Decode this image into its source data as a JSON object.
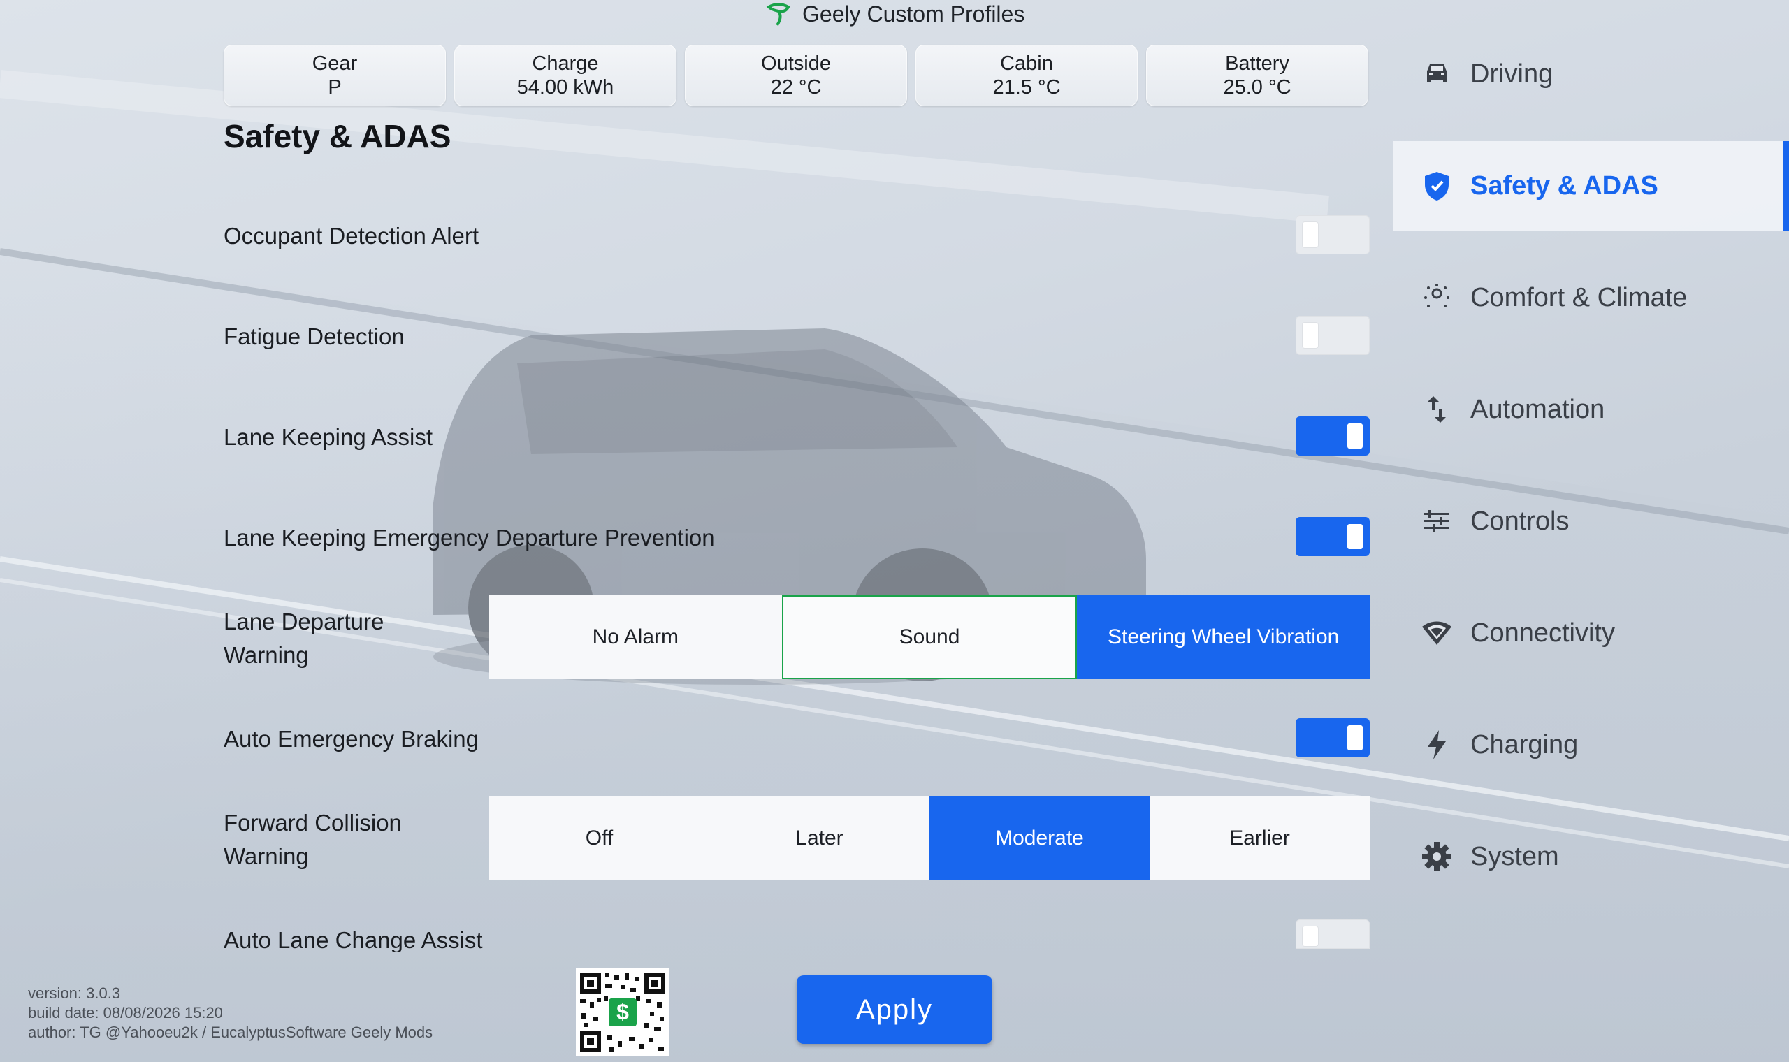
{
  "app": {
    "title": "Geely Custom Profiles"
  },
  "stats": [
    {
      "label": "Gear",
      "value": "P"
    },
    {
      "label": "Charge",
      "value": "54.00 kWh"
    },
    {
      "label": "Outside",
      "value": "22 °C"
    },
    {
      "label": "Cabin",
      "value": "21.5 °C"
    },
    {
      "label": "Battery",
      "value": "25.0 °C"
    }
  ],
  "page": {
    "title": "Safety & ADAS"
  },
  "settings": {
    "occupant_detection": {
      "label": "Occupant Detection Alert",
      "enabled": false
    },
    "fatigue_detection": {
      "label": "Fatigue Detection",
      "enabled": false
    },
    "lane_keeping_assist": {
      "label": "Lane Keeping Assist",
      "enabled": true
    },
    "lane_keeping_emergency": {
      "label": "Lane Keeping Emergency Departure Prevention",
      "enabled": true
    },
    "lane_departure_warning": {
      "label_line1": "Lane Departure",
      "label_line2": "Warning",
      "options": [
        "No Alarm",
        "Sound",
        "Steering Wheel Vibration"
      ],
      "selected": "Steering Wheel Vibration"
    },
    "auto_emergency_braking": {
      "label": "Auto Emergency Braking",
      "enabled": true
    },
    "forward_collision_warning": {
      "label_line1": "Forward Collision",
      "label_line2": "Warning",
      "options": [
        "Off",
        "Later",
        "Moderate",
        "Earlier"
      ],
      "selected": "Moderate"
    },
    "auto_lane_change": {
      "label": "Auto Lane Change Assist",
      "enabled": false
    }
  },
  "sidebar": {
    "items": [
      {
        "label": "Driving",
        "icon": "car-icon",
        "active": false
      },
      {
        "label": "Safety & ADAS",
        "icon": "shield-icon",
        "active": true
      },
      {
        "label": "Comfort & Climate",
        "icon": "climate-icon",
        "active": false
      },
      {
        "label": "Automation",
        "icon": "swap-icon",
        "active": false
      },
      {
        "label": "Controls",
        "icon": "sliders-icon",
        "active": false
      },
      {
        "label": "Connectivity",
        "icon": "wifi-icon",
        "active": false
      },
      {
        "label": "Charging",
        "icon": "bolt-icon",
        "active": false
      },
      {
        "label": "System",
        "icon": "gear-icon",
        "active": false
      }
    ]
  },
  "footer": {
    "version": "version: 3.0.3",
    "build_date": "build date: 08/08/2026 15:20",
    "author": "author: TG @Yahooeu2k / EucalyptusSoftware Geely Mods",
    "qr_symbol": "$"
  },
  "actions": {
    "apply_label": "Apply"
  },
  "colors": {
    "accent": "#1866ee",
    "logo": "#1aa34a",
    "outline": "#1aa34a"
  }
}
